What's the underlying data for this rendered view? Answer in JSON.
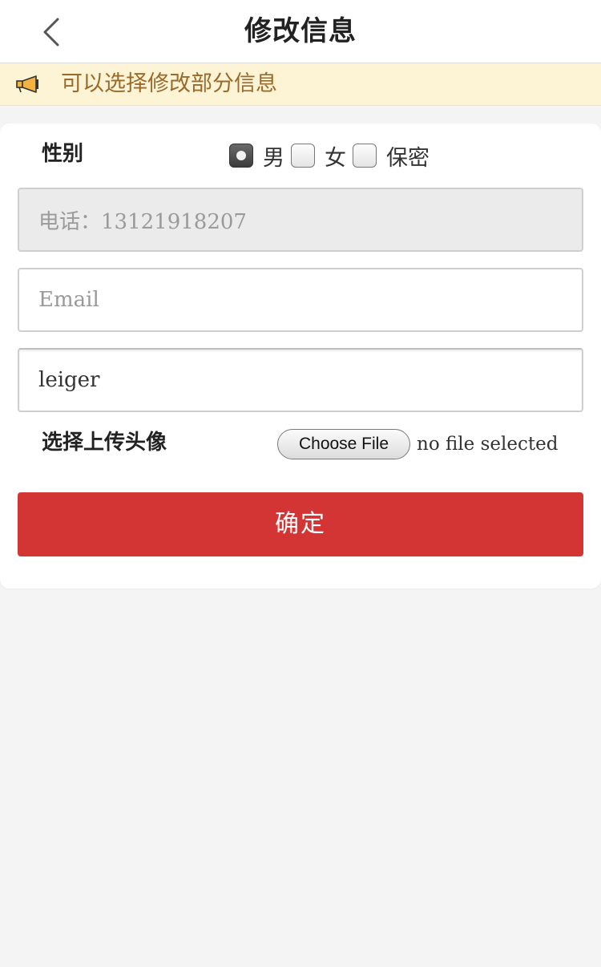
{
  "header": {
    "title": "修改信息",
    "back_icon": "chevron-left-icon"
  },
  "notice": {
    "icon": "megaphone-icon",
    "text": "可以选择修改部分信息"
  },
  "form": {
    "gender": {
      "label": "性别",
      "options": [
        {
          "label": "男",
          "checked": true
        },
        {
          "label": "女",
          "checked": false
        },
        {
          "label": "保密",
          "checked": false
        }
      ]
    },
    "phone": {
      "value": "电话：13121918207"
    },
    "email": {
      "value": "",
      "placeholder": "Email"
    },
    "name": {
      "value": "leiger"
    },
    "avatar_upload": {
      "label": "选择上传头像",
      "button_label": "Choose File",
      "status": "no file selected"
    },
    "submit_label": "确定"
  },
  "colors": {
    "accent": "#d33434",
    "notice_bg": "#fdf4d6",
    "notice_text": "#9a6a2a",
    "page_bg": "#f4f4f4"
  }
}
